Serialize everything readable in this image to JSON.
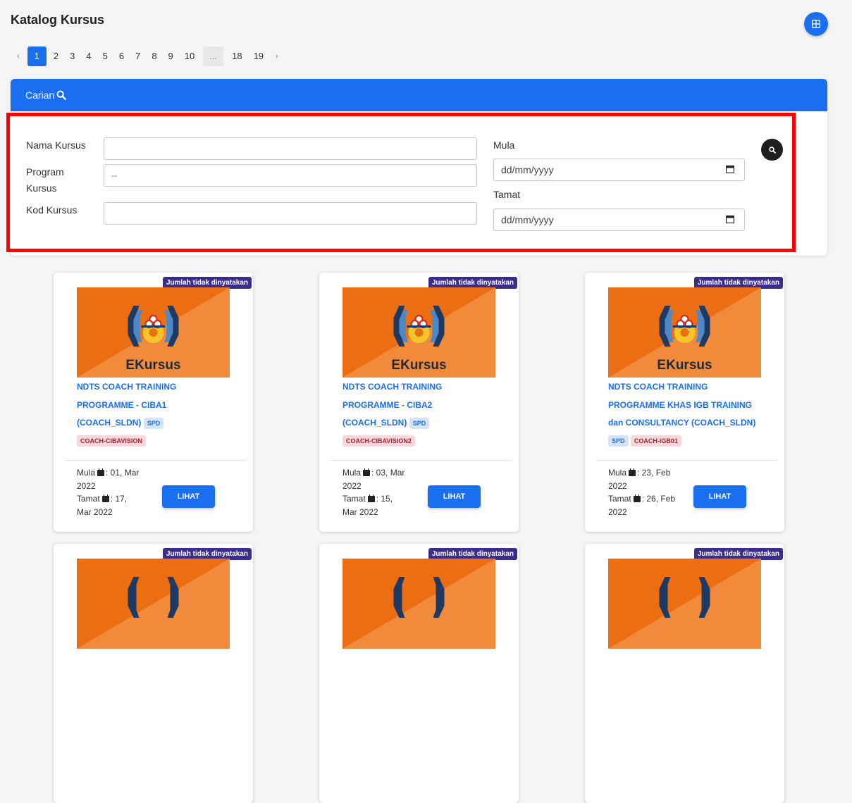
{
  "page": {
    "title": "Katalog Kursus",
    "view_toggle_icon": "grid-icon"
  },
  "pagination": {
    "prev": "‹",
    "next": "›",
    "pages": [
      "1",
      "2",
      "3",
      "4",
      "5",
      "6",
      "7",
      "8",
      "9",
      "10",
      "...",
      "18",
      "19"
    ],
    "active_page": "1"
  },
  "search": {
    "header": "Carian",
    "header_icon": "search-icon",
    "nama_label": "Nama Kursus",
    "nama_value": "",
    "program_label_1": "Program",
    "program_label_2": "Kursus",
    "program_value": "--",
    "kod_label": "Kod Kursus",
    "kod_value": "",
    "mula_label": "Mula",
    "mula_placeholder": "dd/mm/yyyy",
    "tamat_label": "Tamat",
    "tamat_placeholder": "dd/mm/yyyy",
    "submit_icon": "search-icon"
  },
  "colors": {
    "accent": "#1a6ff0",
    "badge": "#3c2d8c",
    "highlight": "#ff0000",
    "tag_code_bg": "#f8d7da",
    "tag_spd_bg": "#d3e4fb",
    "thumb_orange": "#f28a3c"
  },
  "cards": [
    {
      "badge": "Jumlah tidak dinyatakan",
      "thumb_text": "EKursus",
      "title_1": "NDTS COACH TRAINING",
      "title_2": "PROGRAMME - CIBA1",
      "title_3": "(COACH_SLDN)",
      "tag_spd": "SPD",
      "tag_code": "COACH-CIBAVISION",
      "mula": "Mula",
      "mula_date_1": ": 01, Mar",
      "mula_date_2": "2022",
      "tamat": "Tamat",
      "tamat_date_1": ": 17,",
      "tamat_date_2": "Mar 2022",
      "button": "LIHAT"
    },
    {
      "badge": "Jumlah tidak dinyatakan",
      "thumb_text": "EKursus",
      "title_1": "NDTS COACH TRAINING",
      "title_2": "PROGRAMME - CIBA2",
      "title_3": "(COACH_SLDN)",
      "tag_spd": "SPD",
      "tag_code": "COACH-CIBAVISION2",
      "mula": "Mula",
      "mula_date_1": ": 03, Mar",
      "mula_date_2": "2022",
      "tamat": "Tamat",
      "tamat_date_1": ": 15,",
      "tamat_date_2": "Mar 2022",
      "button": "LIHAT"
    },
    {
      "badge": "Jumlah tidak dinyatakan",
      "thumb_text": "EKursus",
      "title_1": "NDTS COACH TRAINING",
      "title_2": "PROGRAMME KHAS IGB TRAINING",
      "title_3": "dan CONSULTANCY (COACH_SLDN)",
      "tag_spd": "SPD",
      "tag_code": "COACH-IGB01",
      "mula": "Mula",
      "mula_date_1": ": 23, Feb",
      "mula_date_2": "2022",
      "tamat": "Tamat",
      "tamat_date_1": ": 26, Feb",
      "tamat_date_2": "2022",
      "button": "LIHAT"
    },
    {
      "badge": "Jumlah tidak dinyatakan"
    },
    {
      "badge": "Jumlah tidak dinyatakan"
    },
    {
      "badge": "Jumlah tidak dinyatakan"
    }
  ]
}
